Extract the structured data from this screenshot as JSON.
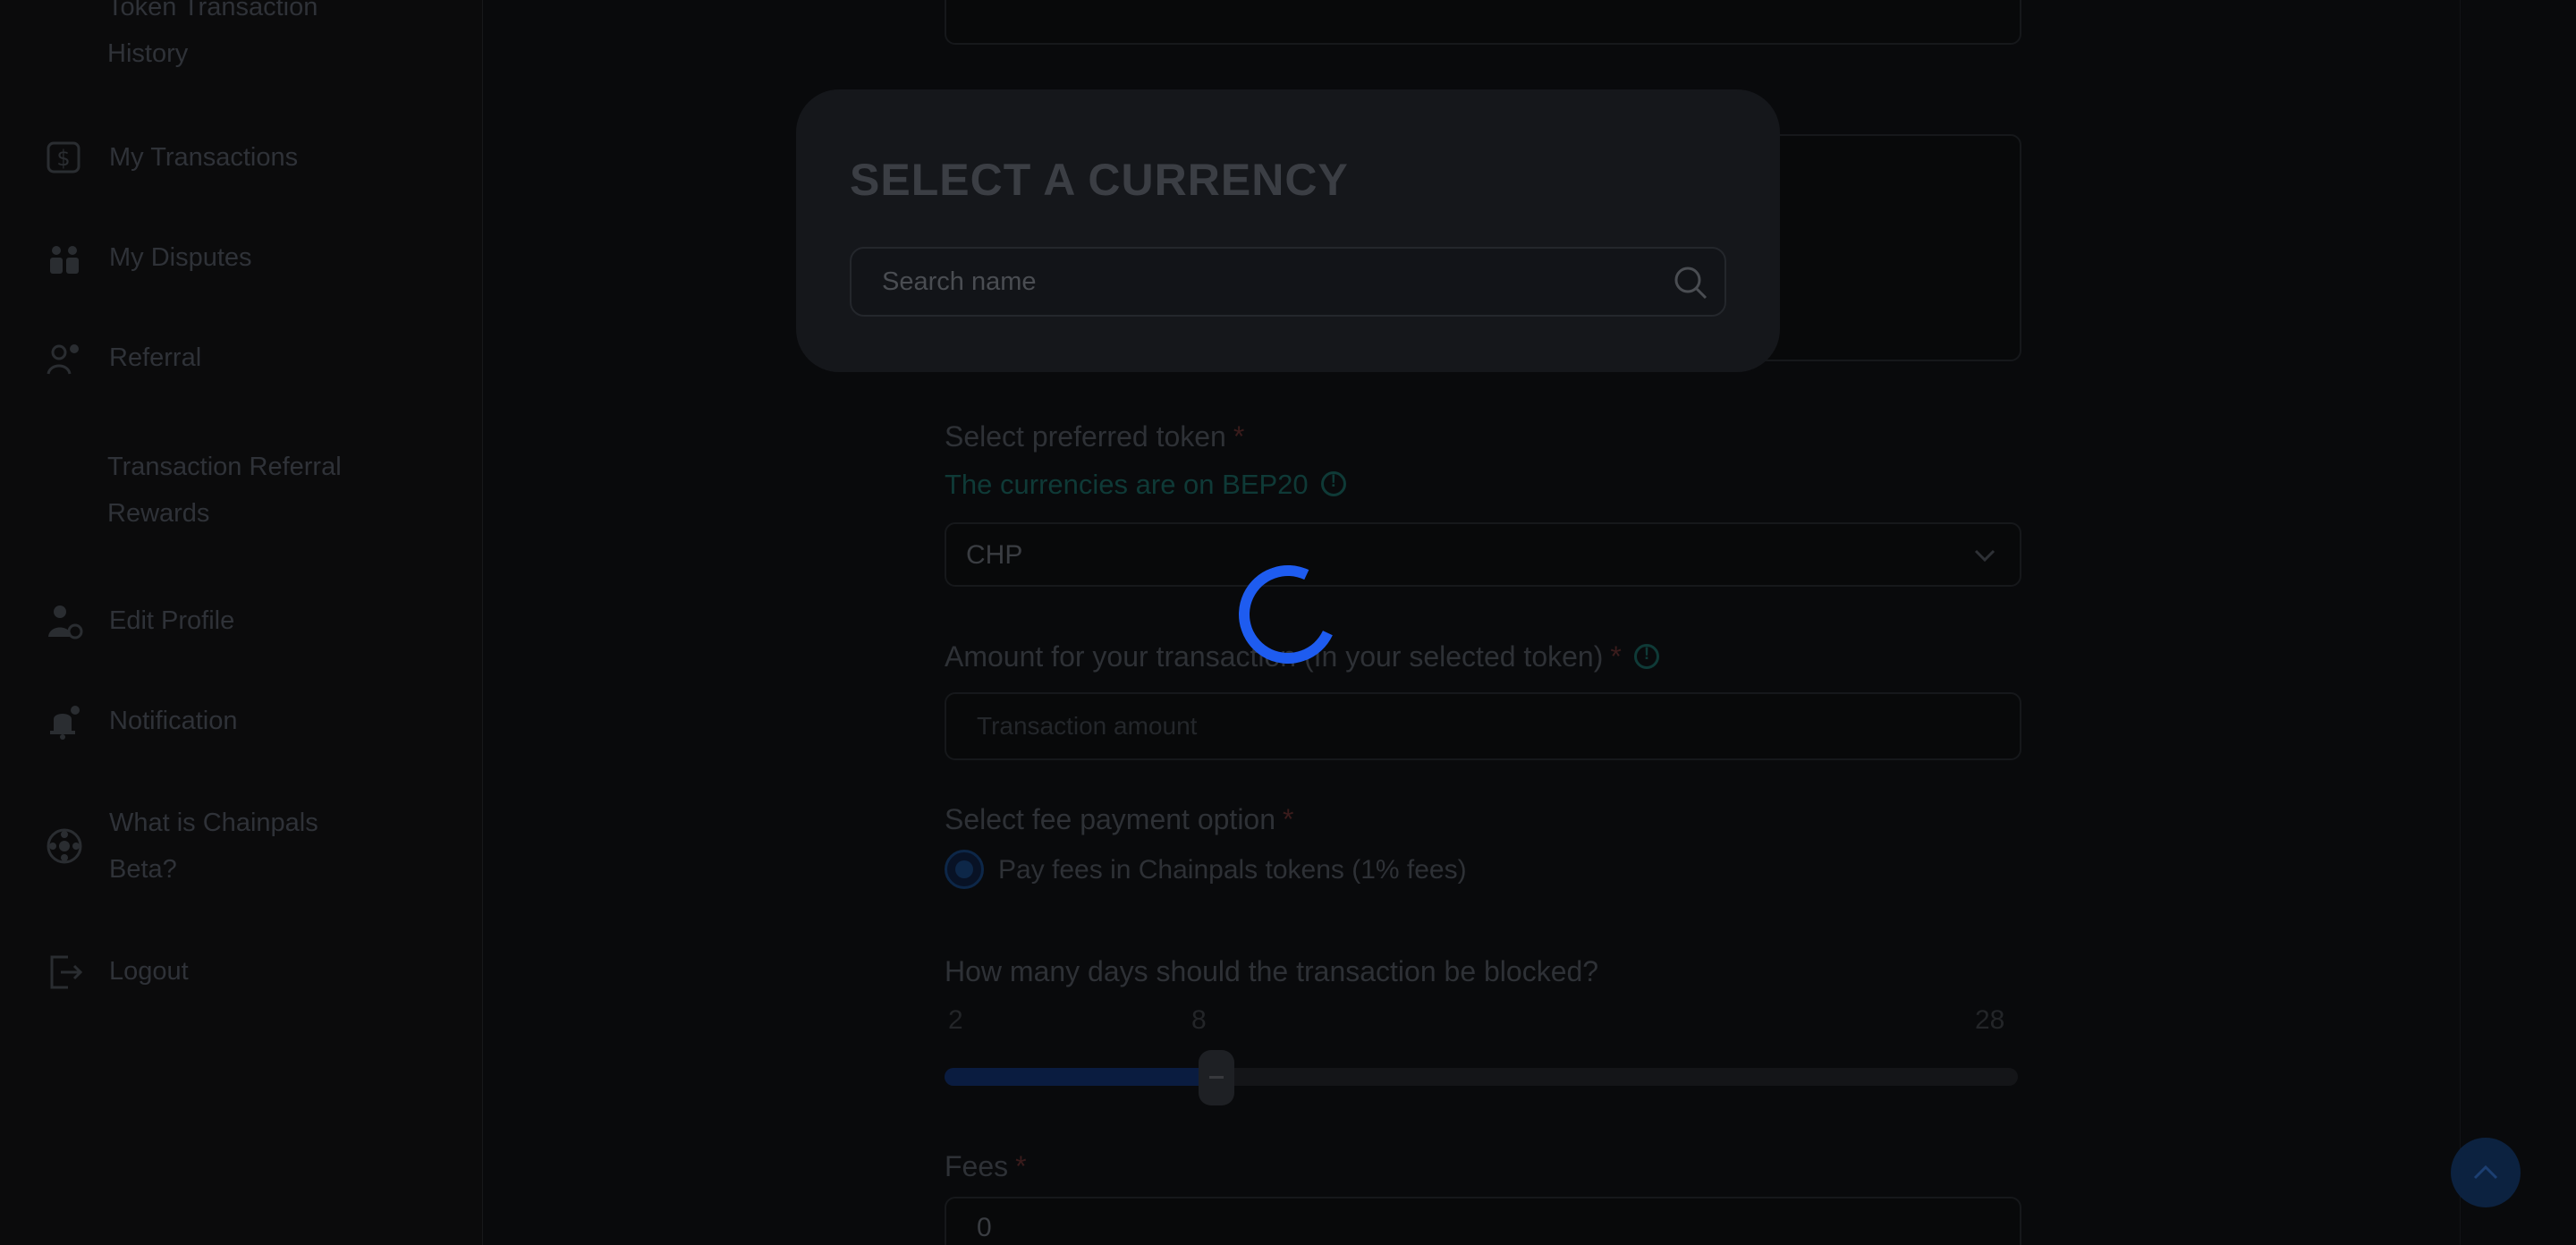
{
  "sidebar": {
    "history_line1": "Token Transaction",
    "history_line2": "History",
    "my_transactions": "My Transactions",
    "my_disputes": "My Disputes",
    "referral": "Referral",
    "transaction_referral_line1": "Transaction Referral",
    "transaction_referral_line2": "Rewards",
    "edit_profile": "Edit Profile",
    "notification": "Notification",
    "what_is_line1": "What is Chainpals",
    "what_is_line2": "Beta?",
    "logout": "Logout"
  },
  "form": {
    "token_label": "Select preferred token",
    "required_mark": "*",
    "token_hint": "The currencies are on BEP20",
    "token_value": "CHP",
    "amount_label": "Amount for your transaction (In your selected token)",
    "amount_placeholder": "Transaction amount",
    "fee_option_label": "Select fee payment option",
    "fee_option_value": "Pay fees in Chainpals tokens (1% fees)",
    "days_label": "How many days should the transaction be blocked?",
    "days_min": "2",
    "days_value": "8",
    "days_max": "28",
    "fees_label": "Fees",
    "fees_value": "0"
  },
  "modal": {
    "title": "SELECT A CURRENCY",
    "search_placeholder": "Search name"
  },
  "colors": {
    "accent": "#1e5cf0",
    "overlay": "#0a0b0d",
    "modal_bg": "#15171b"
  },
  "slider": {
    "min": 2,
    "max": 28,
    "value": 8
  }
}
